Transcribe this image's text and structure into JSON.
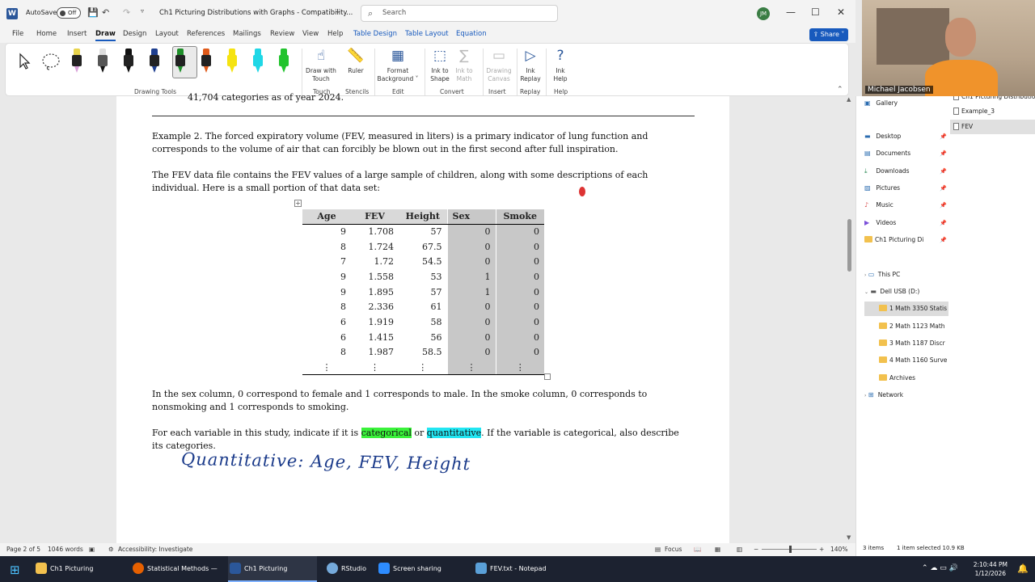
{
  "window": {
    "app_letter": "W",
    "autosave_label": "AutoSave",
    "autosave_state": "Off",
    "document_title": "Ch1 Picturing Distributions with Graphs  -  Compatibility...",
    "search_placeholder": "Search",
    "user_initials": "JM"
  },
  "tabs": [
    "File",
    "Home",
    "Insert",
    "Draw",
    "Design",
    "Layout",
    "References",
    "Mailings",
    "Review",
    "View",
    "Help"
  ],
  "context_tabs": [
    "Table Design",
    "Table Layout",
    "Equation"
  ],
  "active_tab": "Draw",
  "share_label": "Share",
  "ribbon": {
    "groups": [
      "Drawing Tools",
      "Touch",
      "Stencils",
      "Edit",
      "Convert",
      "Insert",
      "Replay",
      "Help"
    ],
    "buttons": {
      "draw_with_touch": "Draw with\nTouch",
      "ruler": "Ruler",
      "format_background": "Format\nBackground ˅",
      "ink_to_shape": "Ink to\nShape",
      "ink_to_math": "Ink to\nMath",
      "drawing_canvas": "Drawing\nCanvas",
      "ink_replay": "Ink\nReplay",
      "ink_help": "Ink\nHelp"
    },
    "pen_colors": [
      "#e8d44d",
      "#111111",
      "#111111",
      "#1f3f8f",
      "#1f8f2a",
      "#e05a1a",
      "#f5e311",
      "#1fd7e6",
      "#22c32e"
    ]
  },
  "document": {
    "cutoff_line": "41,704 categories as of year 2024.",
    "para1": "Example 2.  The forced expiratory volume (FEV, measured in liters) is a primary indicator of lung function and corresponds to the volume of air that can forcibly be blown out in the first second after full inspiration.",
    "para2": "The FEV data file contains the FEV values of a large sample of children, along with some descriptions of each individual.  Here is a small portion of that data set:",
    "table": {
      "headers": [
        "Age",
        "FEV",
        "Height",
        "Sex",
        "Smoke"
      ],
      "rows": [
        [
          "9",
          "1.708",
          "57",
          "0",
          "0"
        ],
        [
          "8",
          "1.724",
          "67.5",
          "0",
          "0"
        ],
        [
          "7",
          "1.72",
          "54.5",
          "0",
          "0"
        ],
        [
          "9",
          "1.558",
          "53",
          "1",
          "0"
        ],
        [
          "9",
          "1.895",
          "57",
          "1",
          "0"
        ],
        [
          "8",
          "2.336",
          "61",
          "0",
          "0"
        ],
        [
          "6",
          "1.919",
          "58",
          "0",
          "0"
        ],
        [
          "6",
          "1.415",
          "56",
          "0",
          "0"
        ],
        [
          "8",
          "1.987",
          "58.5",
          "0",
          "0"
        ]
      ],
      "ellipsis": "⋮"
    },
    "para3": "In the sex column, 0 correspond to female and 1 corresponds to male.  In the smoke column, 0 corresponds to nonsmoking and 1 corresponds to smoking.",
    "para4_a": "For each variable in this study, indicate if it is ",
    "para4_cat": "categorical",
    "para4_or": " or ",
    "para4_quant": "quantitative",
    "para4_b": ".  If the variable is categorical, also describe its categories.",
    "ink_note": "Quantitative: Age, FEV, Height",
    "ink_color": "#1a3a8a"
  },
  "status": {
    "page": "Page 2 of 5",
    "words": "1046 words",
    "accessibility": "Accessibility: Investigate",
    "focus": "Focus",
    "zoom": "140%"
  },
  "explorer": {
    "top_items": [
      "Gallery"
    ],
    "quick_access": [
      "Desktop",
      "Documents",
      "Downloads",
      "Pictures",
      "Music",
      "Videos",
      "Ch1 Picturing Di"
    ],
    "this_pc": "This PC",
    "drive": "Dell USB (D:)",
    "drive_folders": [
      "1 Math 3350 Statis",
      "2 Math 1123 Math",
      "3 Math 1187 Discr",
      "4 Math 1160 Surve",
      "Archives"
    ],
    "network": "Network",
    "files": [
      "Ch1 Picturing Distributio",
      "Example_3",
      "FEV"
    ],
    "status_items": "3 items",
    "status_selected": "1 item selected  10.9 KB"
  },
  "webcam": {
    "name": "Michael Jacobsen"
  },
  "taskbar": {
    "items": [
      "Ch1 Picturing Distributio",
      "Statistical Methods — M",
      "Ch1 Picturing Distributi",
      "RStudio",
      "Screen sharing meeting",
      "FEV.txt - Notepad"
    ],
    "time": "2:10:44 PM",
    "date": "1/12/2026",
    "watermark": "Powered by Zoom"
  }
}
